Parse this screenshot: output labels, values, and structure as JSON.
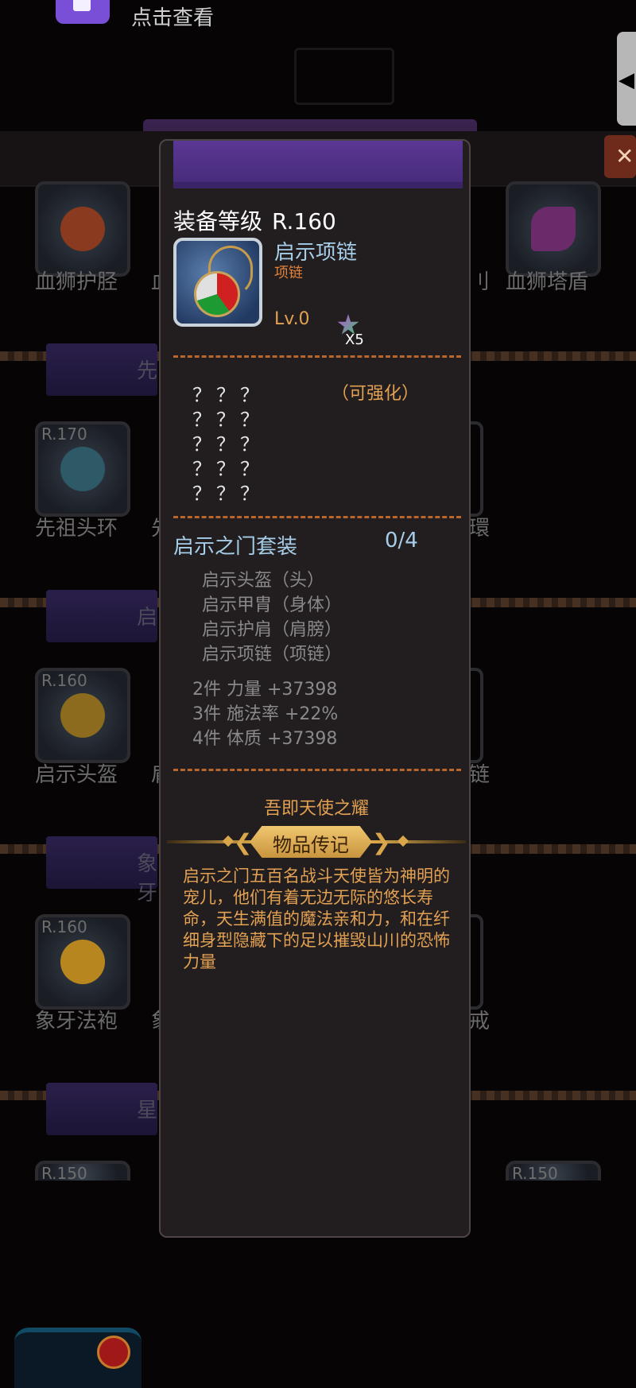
{
  "notification": {
    "text": "点击查看"
  },
  "background": {
    "section_tabs": [
      "先",
      "启",
      "象牙",
      "星"
    ],
    "items": [
      {
        "label": "血狮护胫",
        "rank": ""
      },
      {
        "label": "血狮塔盾",
        "rank": ""
      },
      {
        "label": "先祖头环",
        "rank": "R.170"
      },
      {
        "label": "启示头盔",
        "rank": "R.160"
      },
      {
        "label": "象牙法袍",
        "rank": "R.160"
      },
      {
        "label": "",
        "rank": "R.150"
      },
      {
        "label": "",
        "rank": "R.150"
      }
    ],
    "partial_labels": [
      "血",
      "先",
      "启",
      "象"
    ],
    "close_icon": "close-icon"
  },
  "popup": {
    "level_label": "装备等级",
    "level_value": "R.160",
    "item_name": "启示项链",
    "item_type": "项链",
    "item_level": "Lv.0",
    "star_count": "X5",
    "hidden_stats": [
      "？？？",
      "？？？",
      "？？？",
      "？？？",
      "？？？"
    ],
    "enhance_hint": "（可强化）",
    "set": {
      "name": "启示之门套装",
      "count": "0/4",
      "pieces": [
        "启示头盔（头）",
        "启示甲胄（身体）",
        "启示护肩（肩膀）",
        "启示项链（项链）"
      ],
      "bonuses": [
        "2件  力量 +37398",
        "3件  施法率 +22%",
        "4件  体质 +37398"
      ]
    },
    "motto": "吾即天使之耀",
    "lore_tab": "物品传记",
    "lore_text": "启示之门五百名战斗天使皆为神明的宠儿，他们有着无边无际的悠长寿命，天生满值的魔法亲和力，和在纤细身型隐藏下的足以摧毁山川的恐怖力量"
  },
  "colors": {
    "title_blue": "#a6cde8",
    "accent_orange": "#e2a153",
    "banner_purple": "#5a3794",
    "panel_bg": "#221d1e"
  }
}
